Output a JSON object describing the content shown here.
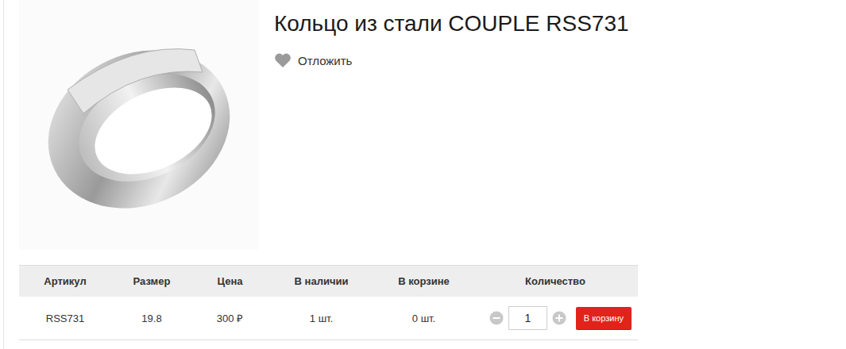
{
  "product": {
    "title": "Кольцо из стали COUPLE RSS731",
    "wishlist": {
      "label": "Отложить",
      "saved": false
    }
  },
  "table": {
    "columns": [
      "Артикул",
      "Размер",
      "Цена",
      "В наличии",
      "В корзине",
      "Количество"
    ],
    "rows": [
      {
        "sku": "RSS731",
        "size": "19.8",
        "price": "300 ₽",
        "stock": "1 шт.",
        "in_cart": "0 шт.",
        "quantity": "1",
        "button": "В корзину"
      }
    ]
  }
}
